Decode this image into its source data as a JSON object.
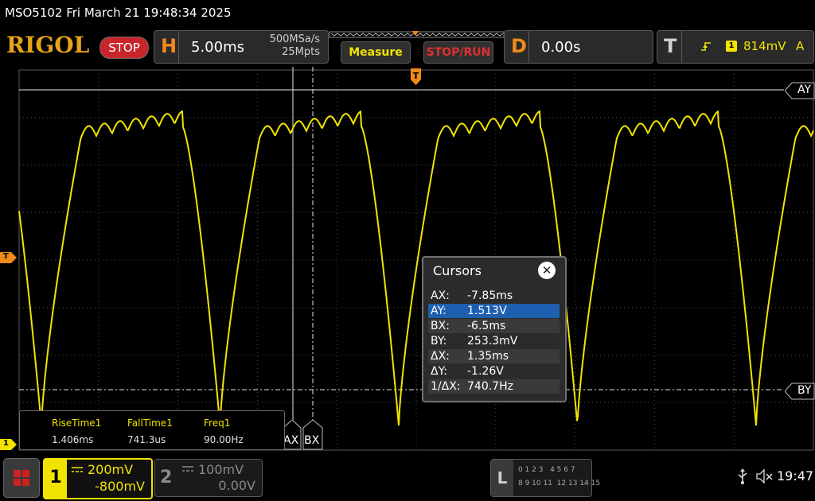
{
  "titlebar": {
    "text": "MSO5102  Fri March 21 19:48:34 2025"
  },
  "brand": {
    "logo": "RIGOL",
    "run_state": "STOP"
  },
  "horizontal": {
    "letter": "H",
    "timebase": "5.00ms",
    "sample_rate": "500MSa/s",
    "memory_depth": "25Mpts"
  },
  "buttons": {
    "measure": "Measure",
    "stop_run": "STOP/RUN"
  },
  "delay": {
    "letter": "D",
    "value": "0.00s"
  },
  "trigger": {
    "letter": "T",
    "channel": "1",
    "level": "814mV",
    "mode": "A"
  },
  "markers": {
    "trigger_top": "T",
    "trigger_level": "T",
    "ch1_ground": "1"
  },
  "cursor_labels": {
    "ay": "AY",
    "by": "BY",
    "ax": "AX",
    "bx": "BX"
  },
  "cursors": {
    "title": "Cursors",
    "close_symbol": "✕",
    "rows": [
      {
        "key": "AX:",
        "value": "-7.85ms"
      },
      {
        "key": "AY:",
        "value": "1.513V"
      },
      {
        "key": "BX:",
        "value": "-6.5ms"
      },
      {
        "key": "BY:",
        "value": "253.3mV"
      },
      {
        "key": "ΔX:",
        "value": "1.35ms"
      },
      {
        "key": "ΔY:",
        "value": "-1.26V"
      },
      {
        "key": "1/ΔX:",
        "value": "740.7Hz"
      }
    ],
    "selected_index": 1
  },
  "measurements": [
    {
      "name": "RiseTime1",
      "value": "1.406ms"
    },
    {
      "name": "FallTime1",
      "value": "741.3us"
    },
    {
      "name": "Freq1",
      "value": "90.00Hz"
    }
  ],
  "channels": [
    {
      "number": "1",
      "scale": "200mV",
      "offset": "-800mV",
      "color": "#f2e400",
      "active": true
    },
    {
      "number": "2",
      "scale": "100mV",
      "offset": "0.00V",
      "color": "#7a7a7a",
      "active": false
    }
  ],
  "logic": {
    "letter": "L",
    "row1": "0 1 2 3   4 5 6 7",
    "row2": "8 9 10 11  12 13 14 15"
  },
  "status": {
    "clock": "19:47"
  },
  "colors": {
    "brand": "#e8a317",
    "accent": "#f08a1a",
    "ch1_trace": "#f2e400",
    "stop_red": "#c8262b",
    "selection": "#1e5fb0"
  },
  "icons": [
    "menu-icon",
    "usb-icon",
    "speaker-muted-icon",
    "trigger-edge-icon",
    "close-icon"
  ]
}
